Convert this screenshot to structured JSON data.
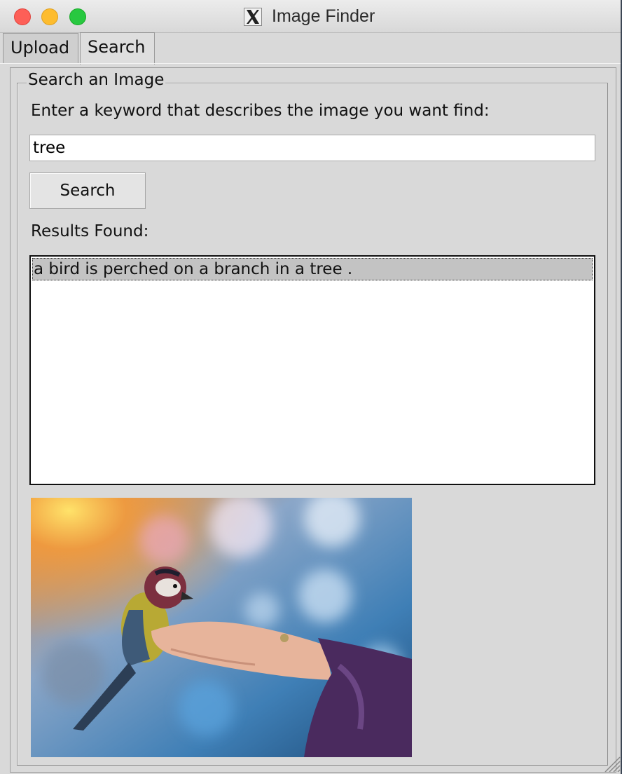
{
  "window": {
    "title": "Image Finder",
    "app_icon": "x11-icon"
  },
  "tabs": [
    {
      "label": "Upload",
      "selected": false
    },
    {
      "label": "Search",
      "selected": true
    }
  ],
  "search_frame": {
    "legend": "Search an Image",
    "prompt": "Enter a keyword that describes the image you want find:",
    "input_value": "tree",
    "button_label": "Search",
    "results_label": "Results Found:",
    "results": [
      "a bird is perched on a branch in a tree ."
    ]
  },
  "colors": {
    "window_bg": "#d9d9d9",
    "selection_bg": "#c3c3c3",
    "close": "#fd5f57",
    "minimize": "#fdbc2e",
    "maximize": "#28c840"
  }
}
